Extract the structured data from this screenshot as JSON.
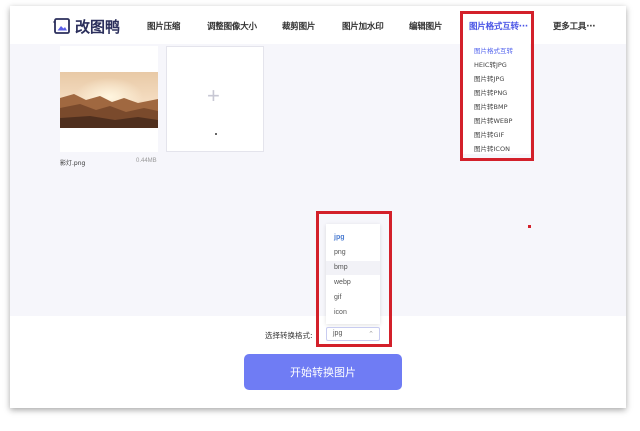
{
  "brand": {
    "name": "改图鸭",
    "logo_icon": "image-frame-icon"
  },
  "nav": {
    "items": [
      {
        "label": "图片压缩"
      },
      {
        "label": "调整图像大小"
      },
      {
        "label": "裁剪图片"
      },
      {
        "label": "图片加水印"
      },
      {
        "label": "编辑图片"
      },
      {
        "label": "图片格式互转···",
        "active": true
      },
      {
        "label": "更多工具···"
      }
    ]
  },
  "format_menu": {
    "items": [
      {
        "label": "图片格式互转",
        "selected": true
      },
      {
        "label": "HEIC转JPG"
      },
      {
        "label": "图片转JPG"
      },
      {
        "label": "图片转PNG"
      },
      {
        "label": "图片转BMP"
      },
      {
        "label": "图片转WEBP"
      },
      {
        "label": "图片转GIF"
      },
      {
        "label": "图片转ICON"
      }
    ]
  },
  "upload": {
    "file_name": "影灯.png",
    "file_size": "0.44MB",
    "add_icon": "plus-icon"
  },
  "format_select": {
    "label": "选择转换格式:",
    "value": "jpg",
    "options": [
      "jpg",
      "png",
      "bmp",
      "webp",
      "gif",
      "icon"
    ],
    "selected": "jpg",
    "hovered": "bmp"
  },
  "convert_button": {
    "label": "开始转换图片"
  },
  "colors": {
    "accent": "#6f7cf4",
    "nav_active": "#4a55e6",
    "highlight": "#d3202a"
  }
}
